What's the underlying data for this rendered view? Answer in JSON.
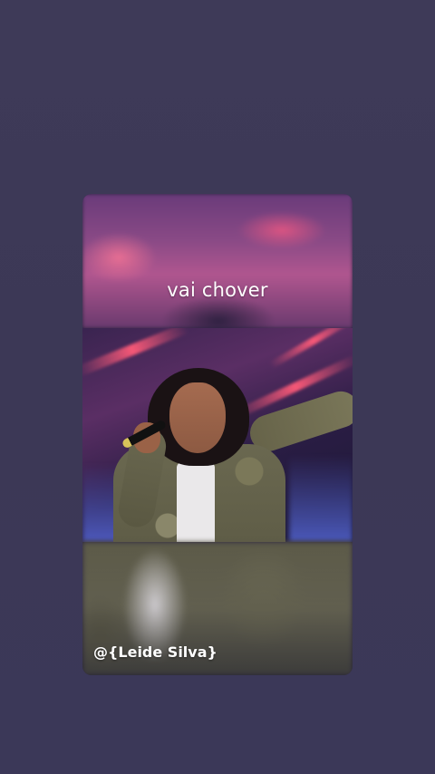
{
  "video": {
    "caption": "vai chover",
    "watermark": "@{Leide Silva}"
  },
  "colors": {
    "background": "#3d3957",
    "caption_text": "#ffffff",
    "stage_light": "#ff5a78"
  }
}
